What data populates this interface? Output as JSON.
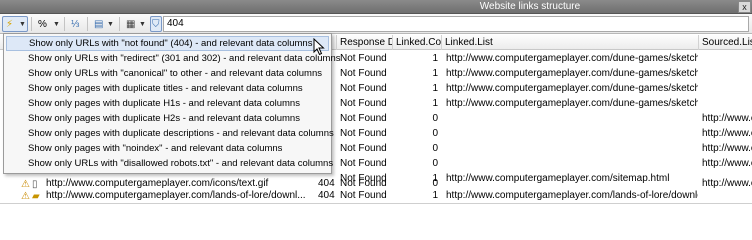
{
  "window": {
    "title": "Website links structure",
    "close_glyph": "x"
  },
  "toolbar": {
    "percent_label": "%",
    "filter_value": "404",
    "icons": [
      "wand-icon",
      "percent-icon",
      "tree-icon",
      "columns-icon",
      "report-icon",
      "filter-icon"
    ]
  },
  "columns": [
    {
      "label": ""
    },
    {
      "label": "Response D..."
    },
    {
      "label": "Linked.Co..."
    },
    {
      "label": "Linked.List"
    },
    {
      "label": "Sourced.List"
    }
  ],
  "rows": [
    {
      "url": "",
      "code": "",
      "response": "Not Found",
      "linked_count": "1",
      "linked_list": "http://www.computergameplayer.com/dune-games/sketches.html",
      "sourced": ""
    },
    {
      "url": "",
      "code": "",
      "response": "Not Found",
      "linked_count": "1",
      "linked_list": "http://www.computergameplayer.com/dune-games/sketches.html",
      "sourced": ""
    },
    {
      "url": "",
      "code": "",
      "response": "Not Found",
      "linked_count": "1",
      "linked_list": "http://www.computergameplayer.com/dune-games/sketches.html",
      "sourced": ""
    },
    {
      "url": "",
      "code": "",
      "response": "Not Found",
      "linked_count": "1",
      "linked_list": "http://www.computergameplayer.com/dune-games/sketches.html",
      "sourced": ""
    },
    {
      "url": "",
      "code": "",
      "response": "Not Found",
      "linked_count": "0",
      "linked_list": "",
      "sourced": "http://www.c"
    },
    {
      "url": "",
      "code": "",
      "response": "Not Found",
      "linked_count": "0",
      "linked_list": "",
      "sourced": "http://www.c"
    },
    {
      "url": "",
      "code": "",
      "response": "Not Found",
      "linked_count": "0",
      "linked_list": "",
      "sourced": "http://www.c"
    },
    {
      "url": "",
      "code": "",
      "response": "Not Found",
      "linked_count": "0",
      "linked_list": "",
      "sourced": "http://www.c"
    },
    {
      "url": "",
      "code": "",
      "response": "Not Found",
      "linked_count": "1",
      "linked_list": "http://www.computergameplayer.com/sitemap.html",
      "sourced": ""
    },
    {
      "url": "http://www.computergameplayer.com/icons/text.gif",
      "code": "404",
      "response": "Not Found",
      "linked_count": "0",
      "linked_list": "",
      "sourced": "http://www.c"
    },
    {
      "url": "http://www.computergameplayer.com/lands-of-lore/downl...",
      "code": "404",
      "response": "Not Found",
      "linked_count": "1",
      "linked_list": "http://www.computergameplayer.com/lands-of-lore/downloads/lo",
      "sourced": ""
    }
  ],
  "menu": {
    "items": [
      {
        "label": "Show only URLs with \"not found\" (404) - and relevant data columns"
      },
      {
        "label": "Show only URLs with \"redirect\" (301 and 302) - and relevant data columns"
      },
      {
        "label": "Show only URLs with \"canonical\" to other - and relevant data columns"
      },
      {
        "label": "Show only pages with duplicate titles - and relevant data columns"
      },
      {
        "label": "Show only pages with duplicate H1s - and relevant data columns"
      },
      {
        "label": "Show only pages with duplicate H2s - and relevant data columns"
      },
      {
        "label": "Show only pages with duplicate descriptions - and relevant data columns"
      },
      {
        "label": "Show only pages with \"noindex\" - and relevant data columns"
      },
      {
        "label": "Show only URLs with \"disallowed robots.txt\" - and relevant data columns"
      }
    ]
  },
  "colors": {
    "menu_highlight": "#dde8f7",
    "title_bar": "#7a7a7a",
    "filter_active": "#dfe9f6"
  }
}
